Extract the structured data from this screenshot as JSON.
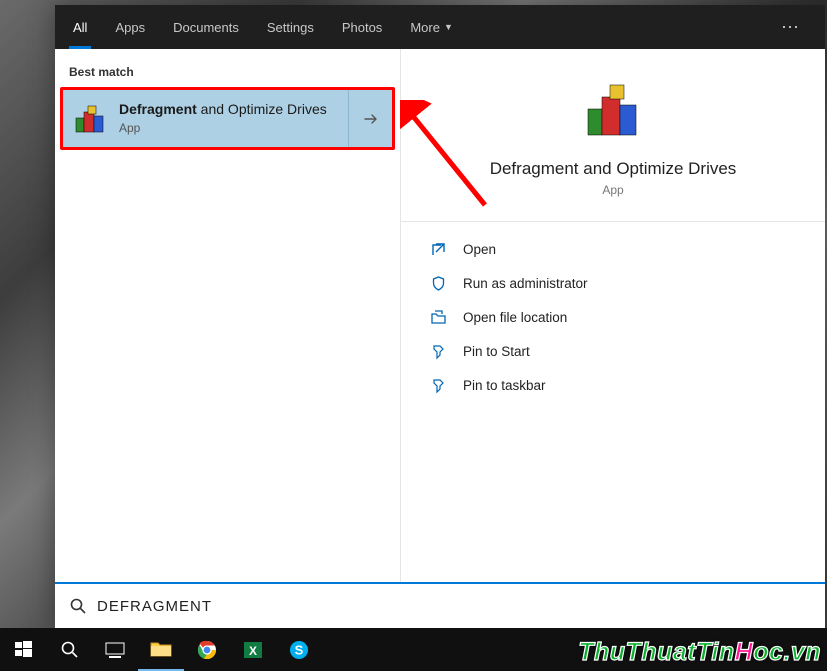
{
  "tabs": {
    "all": "All",
    "apps": "Apps",
    "documents": "Documents",
    "settings": "Settings",
    "photos": "Photos",
    "more": "More"
  },
  "sections": {
    "best_match": "Best match"
  },
  "match": {
    "title_bold": "Defragment",
    "title_rest": " and Optimize Drives",
    "subtitle": "App"
  },
  "preview": {
    "title": "Defragment and Optimize Drives",
    "subtitle": "App"
  },
  "actions": {
    "open": "Open",
    "run_admin": "Run as administrator",
    "open_location": "Open file location",
    "pin_start": "Pin to Start",
    "pin_taskbar": "Pin to taskbar"
  },
  "search": {
    "value": "DEFRAGMENT"
  },
  "watermark": {
    "a": "ThuThuatTin",
    "b": "H",
    "c": "oc.vn"
  }
}
